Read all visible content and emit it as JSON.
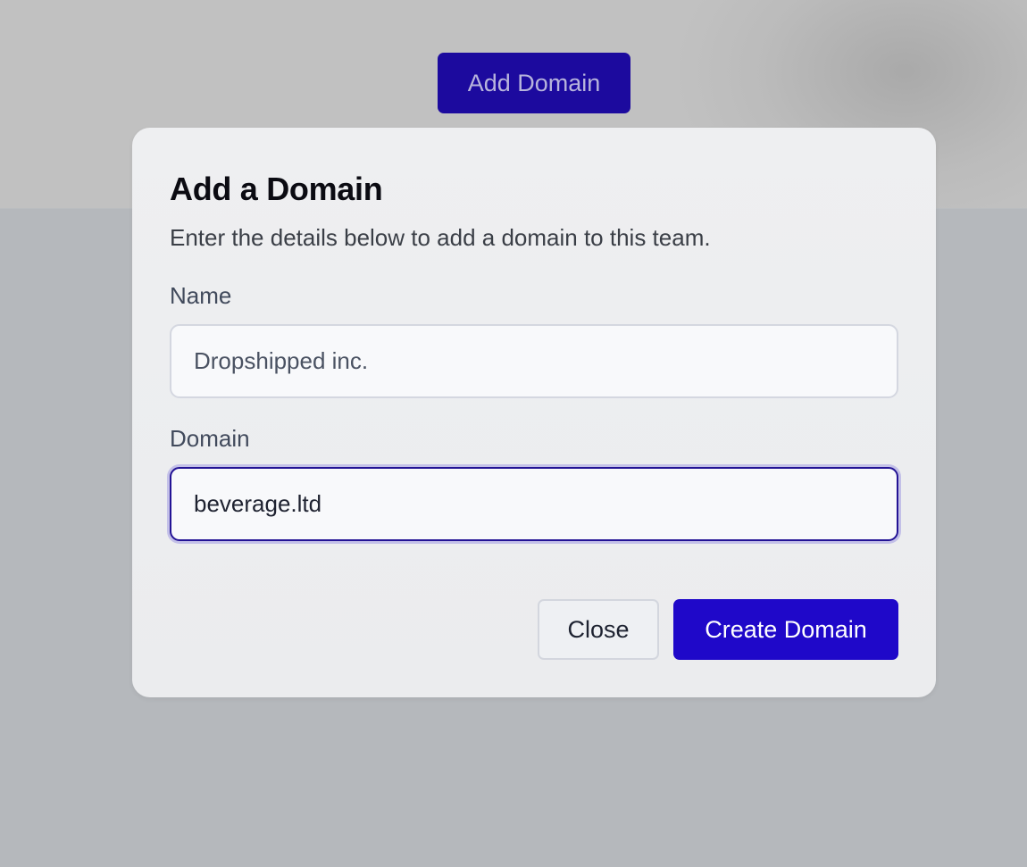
{
  "page": {
    "add_domain_button": "Add Domain"
  },
  "dialog": {
    "title": "Add a Domain",
    "description": "Enter the details below to add a domain to this team.",
    "fields": {
      "name": {
        "label": "Name",
        "value": "Dropshipped inc."
      },
      "domain": {
        "label": "Domain",
        "value": "beverage.ltd"
      }
    },
    "buttons": {
      "close": "Close",
      "create": "Create Domain"
    }
  },
  "colors": {
    "primary": "#1f08c9",
    "overlay": "#b5b8bc",
    "dialog_bg": "#ebecee",
    "focus_border": "#231395"
  }
}
